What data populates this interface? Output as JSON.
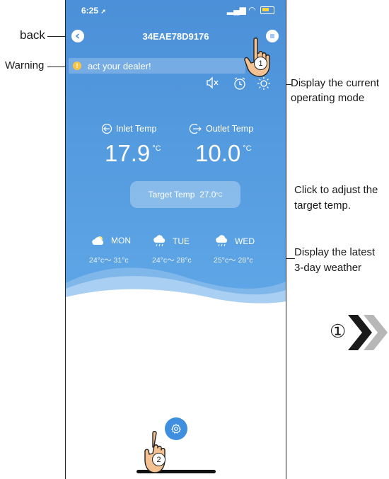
{
  "status": {
    "time": "6:25"
  },
  "header": {
    "title": "34EAE78D9176"
  },
  "warning": {
    "text": "act your dealer!",
    "icon": "exclamation-icon"
  },
  "mode_icons": [
    "mute-icon",
    "alarm-clock-icon",
    "sun-icon"
  ],
  "temps": {
    "inlet_label": "Inlet Temp",
    "outlet_label": "Outlet Temp",
    "inlet_value": "17.9",
    "outlet_value": "10.0",
    "unit": "°C"
  },
  "target": {
    "label": "Target Temp",
    "value": "27.0",
    "unit": "°C"
  },
  "weather": [
    {
      "day": "MON",
      "range": "24°c～ 31°c",
      "icon": "cloud-sun-icon"
    },
    {
      "day": "TUE",
      "range": "24°c～ 28°c",
      "icon": "cloud-rain-icon"
    },
    {
      "day": "WED",
      "range": "25°c～ 28°c",
      "icon": "cloud-rain-icon"
    }
  ],
  "annotations": {
    "back": "back",
    "warning": "Warning",
    "mode_line1": "Display the current",
    "mode_line2": "operating mode",
    "target_line1": "Click to adjust the",
    "target_line2": "target temp.",
    "weather_line1": "Display the latest",
    "weather_line2": "3-day weather",
    "step1": "①",
    "step2": "②"
  },
  "colors": {
    "accent": "#4b90d8",
    "warning": "#f6c545",
    "settings_button": "#3e8fe0"
  }
}
